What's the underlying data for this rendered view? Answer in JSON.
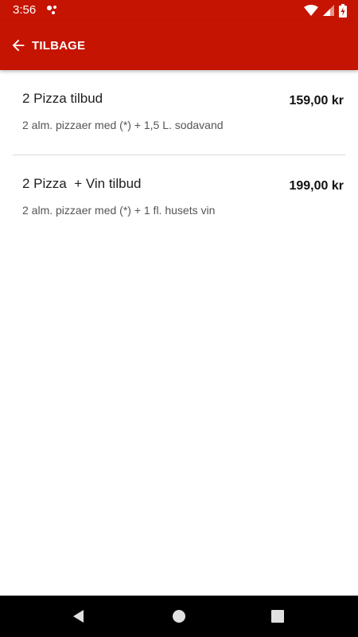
{
  "status_bar": {
    "time": "3:56",
    "icons": [
      "notification-dots-icon",
      "wifi-icon",
      "signal-icon",
      "battery-charging-icon"
    ]
  },
  "toolbar": {
    "back_label": "TILBAGE",
    "background": "#c61402"
  },
  "offers": [
    {
      "title": "2 Pizza tilbud",
      "description": "2 alm. pizzaer med (*) + 1,5 L. sodavand",
      "price": "159,00 kr"
    },
    {
      "title": "2 Pizza  + Vin tilbud",
      "description": "2 alm. pizzaer med (*) + 1 fl. husets vin",
      "price": "199,00 kr"
    }
  ],
  "nav_bar": {
    "icons": [
      "back-triangle-icon",
      "home-circle-icon",
      "recents-square-icon"
    ]
  }
}
